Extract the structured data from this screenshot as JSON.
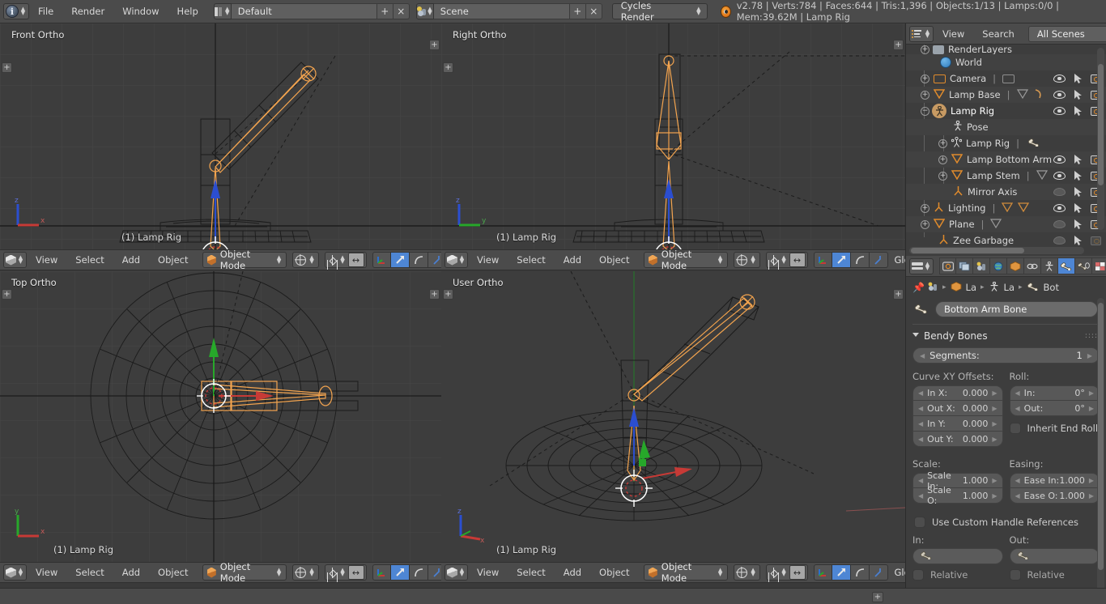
{
  "topbar": {
    "logo_icon": "blender-logo-icon",
    "menus": [
      "File",
      "Render",
      "Window",
      "Help"
    ],
    "screen_layout": {
      "icon": "screen-layout-icon",
      "value": "Default",
      "add_label": "+",
      "delete_label": "×"
    },
    "scene": {
      "icon": "scene-icon",
      "value": "Scene",
      "add_label": "+",
      "delete_label": "×"
    },
    "engine": {
      "value": "Cycles Render",
      "spinner_icon": "spinner-icon"
    },
    "stats_icon": "blender-mini-icon",
    "stats": "v2.78 | Verts:784 | Faces:644 | Tris:1,396 | Objects:1/13 | Lamps:0/0 | Mem:39.62M | Lamp Rig"
  },
  "viewports": [
    {
      "name": "front-ortho",
      "label": "Front Ortho",
      "object_name": "(1) Lamp Rig",
      "gizmo": {
        "axes": [
          "z",
          "x"
        ]
      }
    },
    {
      "name": "right-ortho",
      "label": "Right Ortho",
      "object_name": "(1) Lamp Rig",
      "gizmo": {
        "axes": [
          "z",
          "y"
        ]
      }
    },
    {
      "name": "top-ortho",
      "label": "Top Ortho",
      "object_name": "(1) Lamp Rig",
      "gizmo": {
        "axes": [
          "y",
          "x"
        ]
      }
    },
    {
      "name": "user-ortho",
      "label": "User Ortho",
      "object_name": "(1) Lamp Rig",
      "gizmo": {
        "axes": [
          "z",
          "x"
        ]
      }
    }
  ],
  "viewport_header": {
    "editor_icon": "editor-type-icon",
    "menus": [
      "View",
      "Select",
      "Add",
      "Object"
    ],
    "mode": "Object Mode",
    "mode_icon": "object-mode-cube-icon",
    "shading_icon": "viewport-shading-icon",
    "pivot_icon": "pivot-point-icon",
    "snap_icon": "snap-magnet-icon",
    "manipulators": [
      "translate-manipulator-icon",
      "rotate-manipulator-icon",
      "scale-manipulator-icon",
      "bend-manipulator-icon"
    ],
    "active_manipulator": 1,
    "orientation": "Global",
    "orientation_short": "G"
  },
  "outliner": {
    "editor_icon": "outliner-editor-icon",
    "menus": [
      "View",
      "Search"
    ],
    "display_mode": "All Scenes",
    "rows": [
      {
        "name": "RenderLayers",
        "indent": 1,
        "icon": "renderlayers-icon",
        "expand": "plus",
        "clipped": true,
        "eye": false,
        "arrow": false,
        "camera": false,
        "extra": [
          "renderlayers-data-icon"
        ]
      },
      {
        "name": "World",
        "indent": 2,
        "icon": "world-icon",
        "expand": "none",
        "eye": false,
        "arrow": false,
        "camera": false,
        "extra": []
      },
      {
        "name": "Camera",
        "indent": 1,
        "icon": "camera-icon",
        "expand": "plus",
        "eye": true,
        "arrow": true,
        "camera": true,
        "extra": [
          "camera-data-icon"
        ]
      },
      {
        "name": "Lamp Base",
        "indent": 1,
        "icon": "mesh-icon",
        "expand": "plus",
        "eye": true,
        "arrow": true,
        "camera": true,
        "extra": [
          "mesh-data-icon",
          "modifier-icon"
        ]
      },
      {
        "name": "Lamp Rig",
        "indent": 1,
        "icon": "armature-icon",
        "expand": "minus",
        "eye": true,
        "arrow": true,
        "camera": true,
        "selected": true,
        "extra": []
      },
      {
        "name": "Pose",
        "indent": 3,
        "icon": "pose-icon",
        "expand": "none",
        "eye": false,
        "arrow": false,
        "camera": false,
        "extra": []
      },
      {
        "name": "Lamp Rig",
        "indent": 2,
        "icon": "armature-data-icon",
        "expand": "plus",
        "eye": false,
        "arrow": false,
        "camera": false,
        "extra": [
          "bone-icon"
        ]
      },
      {
        "name": "Lamp Bottom Arm",
        "indent": 2,
        "icon": "mesh-icon",
        "expand": "plus",
        "eye": true,
        "arrow": true,
        "camera": true,
        "extra": []
      },
      {
        "name": "Lamp Stem",
        "indent": 2,
        "icon": "mesh-icon",
        "expand": "plus",
        "eye": true,
        "arrow": true,
        "camera": true,
        "extra": [
          "mesh-data-icon"
        ]
      },
      {
        "name": "Mirror Axis",
        "indent": 3,
        "icon": "empty-axis-icon",
        "expand": "none",
        "eye": "off",
        "arrow": true,
        "camera": true,
        "extra": []
      },
      {
        "name": "Lighting",
        "indent": 1,
        "icon": "empty-axis-icon",
        "expand": "plus",
        "eye": true,
        "arrow": true,
        "camera": true,
        "extra": [
          "mesh-data-icon",
          "mesh-data-icon"
        ]
      },
      {
        "name": "Plane",
        "indent": 1,
        "icon": "mesh-icon",
        "expand": "plus",
        "eye": "off",
        "arrow": true,
        "camera": true,
        "extra": [
          "mesh-data-icon"
        ]
      },
      {
        "name": "Zee Garbage",
        "indent": 2,
        "icon": "empty-axis-icon",
        "expand": "none",
        "eye": "off",
        "arrow": true,
        "camera": "dim",
        "extra": []
      }
    ]
  },
  "properties": {
    "editor_icon": "properties-editor-icon",
    "tabs": [
      {
        "name": "render",
        "icon": "render-camera-icon",
        "active": false
      },
      {
        "name": "render-layers",
        "icon": "render-layers-icon",
        "active": false
      },
      {
        "name": "scene",
        "icon": "scene-icon",
        "active": false
      },
      {
        "name": "world",
        "icon": "world-icon",
        "active": false
      },
      {
        "name": "object",
        "icon": "object-cube-icon",
        "active": false
      },
      {
        "name": "constraints",
        "icon": "chain-constraint-icon",
        "active": false
      },
      {
        "name": "armature",
        "icon": "armature-man-icon",
        "active": false
      },
      {
        "name": "bone",
        "icon": "bone-icon",
        "active": true
      },
      {
        "name": "bone-constraints",
        "icon": "bone-constraint-icon",
        "active": false
      },
      {
        "name": "texture",
        "icon": "texture-checker-icon",
        "active": false
      }
    ],
    "breadcrumb": {
      "pin_icon": "pin-icon",
      "scene_icon": "scene-icon",
      "items": [
        {
          "icon": "object-cube-icon",
          "label": "La"
        },
        {
          "icon": "armature-man-icon",
          "label": "La"
        },
        {
          "icon": "bone-icon",
          "label": "Bot"
        }
      ],
      "separator": "▸"
    },
    "bone_name_icon": "bone-icon",
    "bone_name": "Bottom Arm Bone",
    "panel": {
      "title": "Bendy Bones",
      "expanded": true,
      "grip": "::::",
      "segments": {
        "label": "Segments:",
        "value": "1"
      },
      "curve_label": "Curve XY Offsets:",
      "roll_label": "Roll:",
      "curve_fields": [
        {
          "label": "In X:",
          "value": "0.000"
        },
        {
          "label": "Out X:",
          "value": "0.000"
        },
        {
          "label": "In Y:",
          "value": "0.000"
        },
        {
          "label": "Out Y:",
          "value": "0.000"
        }
      ],
      "roll_fields": [
        {
          "label": "In:",
          "value": "0°"
        },
        {
          "label": "Out:",
          "value": "0°"
        }
      ],
      "inherit_end_roll": {
        "label": "Inherit End Roll",
        "checked": false
      },
      "scale_label": "Scale:",
      "easing_label": "Easing:",
      "scale_fields": [
        {
          "label": "Scale In:",
          "value": "1.000"
        },
        {
          "label": "Scale O:",
          "value": "1.000"
        }
      ],
      "easing_fields": [
        {
          "label": "Ease In:",
          "value": "1.000"
        },
        {
          "label": "Ease O:",
          "value": "1.000"
        }
      ],
      "custom_handles": {
        "label": "Use Custom Handle References",
        "checked": false
      },
      "handle_in_label": "In:",
      "handle_out_label": "Out:",
      "handle_in_value": "",
      "handle_out_value": "",
      "relative_in": {
        "label": "Relative",
        "checked": false
      },
      "relative_out": {
        "label": "Relative",
        "checked": false
      }
    }
  },
  "colors": {
    "accent_blue": "#4e86d4",
    "bone_orange": "#f0a04b",
    "axis_x_red": "#c73a36",
    "axis_y_green": "#27a82a",
    "axis_z_blue": "#2b4ed0",
    "panel_bg": "#3d3d3d",
    "header_bg": "#4b4b4b",
    "viewport_bg": "#3d3d3d"
  },
  "statusbar": {
    "add_button": "+"
  }
}
